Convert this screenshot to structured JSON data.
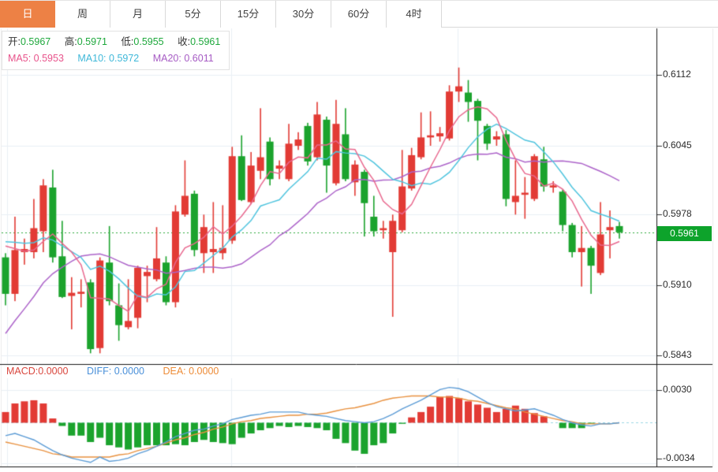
{
  "tabs": {
    "items": [
      {
        "label": "日",
        "active": true
      },
      {
        "label": "周",
        "active": false
      },
      {
        "label": "月",
        "active": false
      },
      {
        "label": "5分",
        "active": false
      },
      {
        "label": "15分",
        "active": false
      },
      {
        "label": "30分",
        "active": false
      },
      {
        "label": "60分",
        "active": false
      },
      {
        "label": "4时",
        "active": false
      }
    ]
  },
  "info_box": {
    "open_label": "开:",
    "open": "0.5967",
    "high_label": "高:",
    "high": "0.5971",
    "low_label": "低:",
    "low": "0.5955",
    "close_label": "收:",
    "close": "0.5961",
    "ma5_label": "MA5:",
    "ma5": "0.5953",
    "ma10_label": "MA10:",
    "ma10": "0.5972",
    "ma20_label": "MA20:",
    "ma20": "0.6011"
  },
  "macd_header": {
    "macd_label": "MACD:",
    "macd": "0.0000",
    "diff_label": "DIFF:",
    "diff": "0.0000",
    "dea_label": "DEA:",
    "dea": "0.0000"
  },
  "price_axis": {
    "ticks": [
      "0.6112",
      "0.6045",
      "0.5978",
      "0.5910",
      "0.5843"
    ],
    "current": "0.5961"
  },
  "macd_axis": {
    "ticks": [
      "0.0030",
      "-0.0034"
    ]
  },
  "colors": {
    "up": "#e23b35",
    "down": "#1ba32d",
    "badge": "#0da32b",
    "ma5": "#e8688e",
    "ma10": "#4fc4de",
    "ma20": "#ac63c9",
    "diff_line": "#5b9bd5",
    "dea_line": "#e8913f",
    "grid": "#e9eff5",
    "frame_dark": "#1a1a1a",
    "frame_light": "#ececec",
    "tick": "#333333",
    "current_dotted": "#2fa83c",
    "zero_dash": "#9bd7e5",
    "tab_active": "#ed8145"
  },
  "chart_data": {
    "type": "candlestick+macd",
    "timeframe_selected": "日",
    "price_ticks": [
      0.6112,
      0.6045,
      0.5978,
      0.591,
      0.5843
    ],
    "current_price": 0.5961,
    "last_bar": {
      "open": 0.5967,
      "high": 0.5971,
      "low": 0.5955,
      "close": 0.5961
    },
    "ma_values_last": {
      "ma5": 0.5953,
      "ma10": 0.5972,
      "ma20": 0.6011
    },
    "macd_ticks": [
      0.003,
      -0.0034
    ],
    "macd_last": {
      "macd": 0.0,
      "diff": 0.0,
      "dea": 0.0
    },
    "candles": [
      [
        0.5937,
        0.5941,
        0.5891,
        0.5902
      ],
      [
        0.5902,
        0.5976,
        0.5895,
        0.5944
      ],
      [
        0.5942,
        0.5955,
        0.593,
        0.5945
      ],
      [
        0.5942,
        0.5993,
        0.5936,
        0.5965
      ],
      [
        0.5962,
        0.6012,
        0.5942,
        0.6006
      ],
      [
        0.6004,
        0.6021,
        0.5932,
        0.5937
      ],
      [
        0.5938,
        0.5972,
        0.5898,
        0.5899
      ],
      [
        0.59,
        0.5918,
        0.5868,
        0.5903
      ],
      [
        0.5902,
        0.5916,
        0.5889,
        0.5904
      ],
      [
        0.5913,
        0.5916,
        0.5845,
        0.5849
      ],
      [
        0.585,
        0.5937,
        0.5845,
        0.5934
      ],
      [
        0.5932,
        0.5967,
        0.5891,
        0.5895
      ],
      [
        0.5891,
        0.5912,
        0.5857,
        0.5872
      ],
      [
        0.587,
        0.5916,
        0.5868,
        0.5876
      ],
      [
        0.5879,
        0.5929,
        0.5869,
        0.5927
      ],
      [
        0.5919,
        0.5929,
        0.5894,
        0.5923
      ],
      [
        0.5916,
        0.5966,
        0.5914,
        0.5936
      ],
      [
        0.5932,
        0.5938,
        0.5891,
        0.5894
      ],
      [
        0.5894,
        0.5987,
        0.5889,
        0.5981
      ],
      [
        0.5978,
        0.603,
        0.5976,
        0.5996
      ],
      [
        0.5998,
        0.6001,
        0.5938,
        0.5944
      ],
      [
        0.5941,
        0.5978,
        0.5922,
        0.5966
      ],
      [
        0.5942,
        0.599,
        0.5922,
        0.5945
      ],
      [
        0.5941,
        0.5987,
        0.5935,
        0.5946
      ],
      [
        0.5953,
        0.6043,
        0.595,
        0.6034
      ],
      [
        0.6034,
        0.6054,
        0.5991,
        0.5992
      ],
      [
        0.599,
        0.6038,
        0.5988,
        0.6025
      ],
      [
        0.602,
        0.608,
        0.6012,
        0.6033
      ],
      [
        0.6048,
        0.6052,
        0.6006,
        0.6012
      ],
      [
        0.6022,
        0.603,
        0.6012,
        0.6025
      ],
      [
        0.6012,
        0.6065,
        0.601,
        0.6046
      ],
      [
        0.6044,
        0.6057,
        0.604,
        0.605
      ],
      [
        0.6063,
        0.6066,
        0.6025,
        0.6029
      ],
      [
        0.6033,
        0.6086,
        0.603,
        0.6074
      ],
      [
        0.6069,
        0.6072,
        0.5999,
        0.6025
      ],
      [
        0.6008,
        0.6088,
        0.6006,
        0.6065
      ],
      [
        0.6055,
        0.608,
        0.601,
        0.6012
      ],
      [
        0.6009,
        0.603,
        0.5996,
        0.6026
      ],
      [
        0.6019,
        0.6021,
        0.5957,
        0.5989
      ],
      [
        0.5976,
        0.5996,
        0.5957,
        0.5962
      ],
      [
        0.5963,
        0.5972,
        0.5955,
        0.5965
      ],
      [
        0.5942,
        0.5978,
        0.588,
        0.5972
      ],
      [
        0.5963,
        0.604,
        0.5961,
        0.6005
      ],
      [
        0.6003,
        0.6042,
        0.6001,
        0.6035
      ],
      [
        0.6033,
        0.6076,
        0.6031,
        0.6052
      ],
      [
        0.6052,
        0.6077,
        0.6044,
        0.6054
      ],
      [
        0.6053,
        0.6062,
        0.6048,
        0.6056
      ],
      [
        0.6051,
        0.6102,
        0.6049,
        0.6096
      ],
      [
        0.6096,
        0.6119,
        0.6086,
        0.6101
      ],
      [
        0.6095,
        0.6107,
        0.6067,
        0.6086
      ],
      [
        0.6087,
        0.6089,
        0.603,
        0.6068
      ],
      [
        0.6063,
        0.6065,
        0.604,
        0.6046
      ],
      [
        0.605,
        0.6058,
        0.6044,
        0.6053
      ],
      [
        0.6055,
        0.6059,
        0.5986,
        0.5993
      ],
      [
        0.599,
        0.603,
        0.5978,
        0.5996
      ],
      [
        0.5997,
        0.6014,
        0.5974,
        0.5999
      ],
      [
        0.5993,
        0.6036,
        0.5991,
        0.6034
      ],
      [
        0.6031,
        0.6043,
        0.6,
        0.6005
      ],
      [
        0.6004,
        0.601,
        0.5999,
        0.6006
      ],
      [
        0.6,
        0.6002,
        0.5962,
        0.5968
      ],
      [
        0.5968,
        0.597,
        0.5937,
        0.5942
      ],
      [
        0.5942,
        0.5967,
        0.5909,
        0.5946
      ],
      [
        0.5946,
        0.5948,
        0.5902,
        0.5929
      ],
      [
        0.5922,
        0.599,
        0.592,
        0.5959
      ],
      [
        0.5963,
        0.5982,
        0.5936,
        0.5966
      ],
      [
        0.5967,
        0.5971,
        0.5955,
        0.5961
      ]
    ],
    "ma_warmup_closes": [
      0.57,
      0.5715,
      0.573,
      0.5745,
      0.576,
      0.5775,
      0.579,
      0.5805,
      0.582,
      0.592,
      0.595,
      0.5955,
      0.5958,
      0.596,
      0.5958,
      0.5956,
      0.5957,
      0.596,
      0.5964
    ],
    "macd": {
      "histogram": [
        0.001,
        0.0018,
        0.002,
        0.0021,
        0.0018,
        0.0004,
        -0.0003,
        -0.0012,
        -0.0012,
        -0.0018,
        -0.0014,
        -0.0021,
        -0.0023,
        -0.0025,
        -0.0023,
        -0.0021,
        -0.0021,
        -0.0021,
        -0.002,
        -0.0021,
        -0.0018,
        -0.0016,
        -0.0018,
        -0.0019,
        -0.002,
        -0.0014,
        -0.001,
        -0.0007,
        -0.0005,
        -0.0003,
        -0.0004,
        -0.0003,
        -0.0004,
        -0.0005,
        -0.0007,
        -0.0015,
        -0.0019,
        -0.0026,
        -0.0029,
        -0.0021,
        -0.0019,
        -0.001,
        -0.0001,
        0.0005,
        0.001,
        0.0015,
        0.0024,
        0.0025,
        0.0023,
        0.002,
        0.0017,
        0.0014,
        0.001,
        0.0013,
        0.0016,
        0.0013,
        0.0009,
        0.0006,
        0.0,
        -0.0005,
        -0.0005,
        -0.0005,
        -0.0001,
        0.0,
        0.0,
        0.0
      ],
      "diff": [
        -0.0012,
        -0.001,
        -0.0013,
        -0.0016,
        -0.0021,
        -0.0026,
        -0.003,
        -0.0033,
        -0.0035,
        -0.0037,
        -0.0032,
        -0.0036,
        -0.0035,
        -0.0033,
        -0.0029,
        -0.0026,
        -0.0022,
        -0.0018,
        -0.0013,
        -0.001,
        -0.0007,
        -0.0006,
        -0.0003,
        -0.0001,
        0.0003,
        0.0005,
        0.0007,
        0.0008,
        0.001,
        0.001,
        0.001,
        0.001,
        0.0008,
        0.0007,
        0.0006,
        0.0004,
        0.0002,
        0.0001,
        0.0,
        0.0001,
        0.0004,
        0.0008,
        0.0013,
        0.0017,
        0.0021,
        0.0026,
        0.0031,
        0.0033,
        0.0032,
        0.0029,
        0.0024,
        0.0019,
        0.0015,
        0.0013,
        0.0011,
        0.0012,
        0.0013,
        0.001,
        0.0007,
        0.0003,
        0.0,
        -0.0002,
        -0.0003,
        -0.0001,
        -0.0001,
        0.0
      ],
      "dea": [
        -0.0018,
        -0.002,
        -0.0022,
        -0.0024,
        -0.0026,
        -0.0029,
        -0.003,
        -0.0032,
        -0.0032,
        -0.0032,
        -0.0032,
        -0.0032,
        -0.003,
        -0.0029,
        -0.0026,
        -0.0024,
        -0.0022,
        -0.0019,
        -0.0016,
        -0.0014,
        -0.0011,
        -0.0009,
        -0.0006,
        -0.0004,
        -0.0001,
        0.0001,
        0.0002,
        0.0004,
        0.0005,
        0.0006,
        0.0007,
        0.0007,
        0.0008,
        0.0008,
        0.0009,
        0.0011,
        0.0013,
        0.0014,
        0.0016,
        0.0018,
        0.0021,
        0.0023,
        0.0024,
        0.0025,
        0.0025,
        0.0025,
        0.0024,
        0.0024,
        0.0023,
        0.0021,
        0.002,
        0.0018,
        0.0016,
        0.0014,
        0.0013,
        0.001,
        0.0008,
        0.0006,
        0.0004,
        0.0002,
        0.0001,
        -0.0001,
        -0.0001,
        -0.0001,
        -0.0001,
        0.0
      ]
    }
  }
}
